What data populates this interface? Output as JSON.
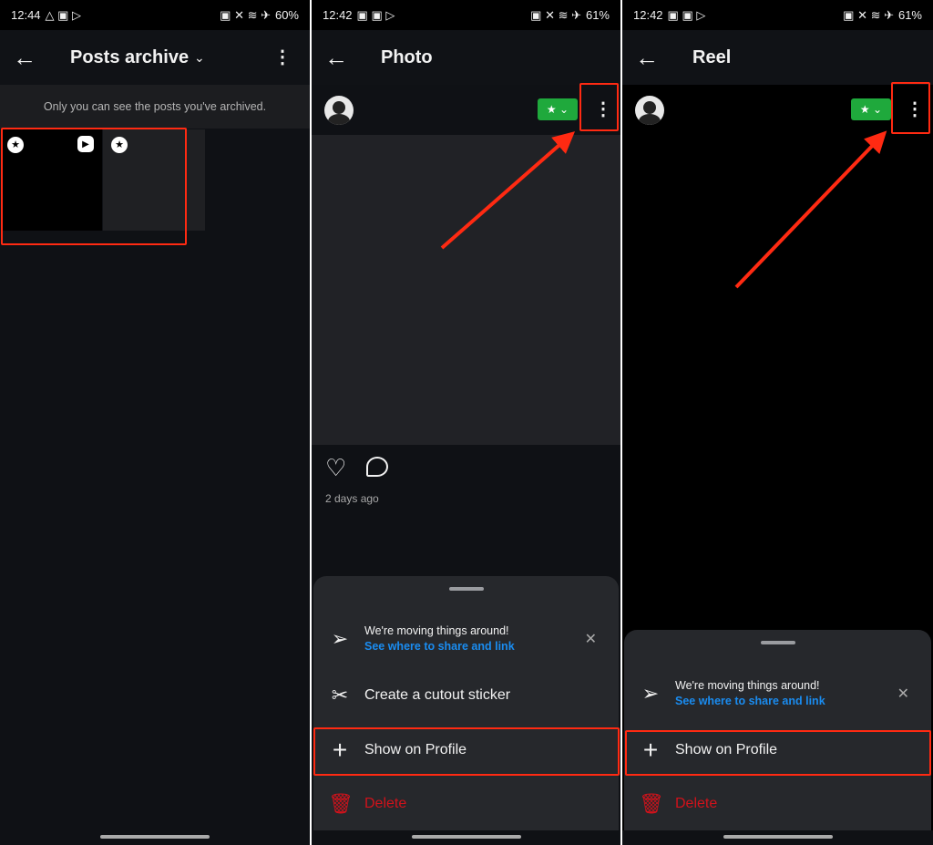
{
  "panels": [
    {
      "status": {
        "time": "12:44",
        "battery": "60%"
      },
      "title": "Posts archive",
      "notice": "Only you can see the posts you've archived."
    },
    {
      "status": {
        "time": "12:42",
        "battery": "61%"
      },
      "title": "Photo",
      "timestamp": "2 days ago",
      "sheet": {
        "notice_title": "We're moving things around!",
        "notice_link": "See where to share and link",
        "cutout": "Create a cutout sticker",
        "show_on_profile": "Show on Profile",
        "delete": "Delete"
      }
    },
    {
      "status": {
        "time": "12:42",
        "battery": "61%"
      },
      "title": "Reel",
      "sheet": {
        "notice_title": "We're moving things around!",
        "notice_link": "See where to share and link",
        "show_on_profile": "Show on Profile",
        "delete": "Delete"
      }
    }
  ],
  "colors": {
    "highlight": "#ff2a12",
    "badge": "#1fa93c",
    "link": "#1a8cf0",
    "delete": "#d1121b"
  }
}
